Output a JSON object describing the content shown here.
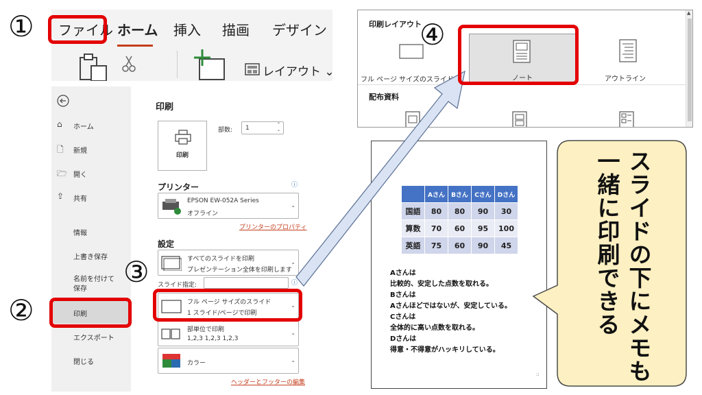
{
  "ribbon": {
    "tabs": [
      "ファイル",
      "ホーム",
      "挿入",
      "描画",
      "デザイン"
    ],
    "layout_label": "レイアウト"
  },
  "backstage": {
    "nav": [
      {
        "label": "ホーム",
        "icon": "home-icon"
      },
      {
        "label": "新規",
        "icon": "new-file-icon"
      },
      {
        "label": "開く",
        "icon": "folder-open-icon"
      },
      {
        "label": "共有",
        "icon": "share-icon"
      }
    ],
    "nav_secondary": [
      "情報",
      "上書き保存",
      "名前を付けて保存",
      "印刷",
      "エクスポート",
      "閉じる"
    ],
    "print_title": "印刷",
    "print_button_label": "印刷",
    "copies_label": "部数:",
    "copies_value": "1",
    "printer_title": "プリンター",
    "printer_name": "EPSON EW-052A Series",
    "printer_status": "オフライン",
    "printer_properties": "プリンターのプロパティ",
    "settings_title": "設定",
    "setting_slides": {
      "line1": "すべてのスライドを印刷",
      "line2": "プレゼンテーション全体を印刷します"
    },
    "slide_spec_label": "スライド指定:",
    "setting_layout": {
      "line1": "フル ページ サイズのスライド",
      "line2": "1 スライド/ページで印刷"
    },
    "setting_collate": {
      "line1": "部単位で印刷",
      "line2": "1,2,3    1,2,3    1,2,3"
    },
    "setting_color": "カラー",
    "header_footer_link": "ヘッダーとフッターの編集"
  },
  "popup": {
    "section1": "印刷レイアウト",
    "opt_full": "フル ページ サイズのスライド",
    "opt_notes": "ノート",
    "opt_outline": "アウトライン",
    "section2": "配布資料"
  },
  "preview": {
    "table_header": [
      "Aさん",
      "Bさん",
      "Cさん",
      "Dさん"
    ],
    "table_rows": [
      {
        "label": "国語",
        "values": [
          "80",
          "80",
          "90",
          "30"
        ]
      },
      {
        "label": "算数",
        "values": [
          "70",
          "60",
          "95",
          "100"
        ]
      },
      {
        "label": "英語",
        "values": [
          "75",
          "60",
          "90",
          "45"
        ]
      }
    ],
    "memo_lines": [
      "Aさんは",
      "比較的、安定した点数を取れる。",
      "Bさんは",
      "Aさんほどではないが、安定している。",
      "Cさんは",
      "全体的に高い点数を取れる。",
      "Dさんは",
      "得意・不得意がハッキリしている。"
    ]
  },
  "callout": "スライドの下にメモも一緒に印刷できる",
  "markers": [
    "①",
    "②",
    "③",
    "④"
  ],
  "colors": {
    "highlight": "#e30000",
    "accent": "#c43e1c",
    "callout_fill": "#fdf0c2",
    "arrow_fill": "#d9e3f3"
  }
}
